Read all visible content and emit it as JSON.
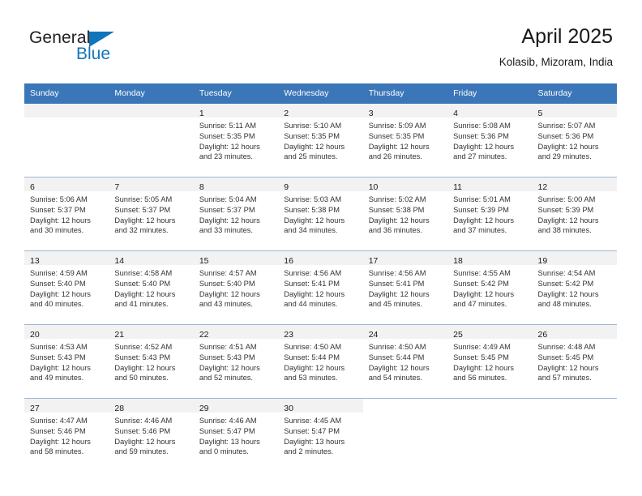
{
  "brand": {
    "name_top": "General",
    "name_bottom": "Blue",
    "triangle_color": "#1175bb",
    "text_color": "#231f20"
  },
  "header": {
    "title": "April 2025",
    "subtitle": "Kolasib, Mizoram, India"
  },
  "theme": {
    "header_bg": "#3a76b8",
    "header_text": "#ffffff",
    "daynum_band": "#f2f2f2",
    "grid_line": "#9db8d6",
    "cell_bg": "#ffffff"
  },
  "calendar": {
    "weekday_headers": [
      "Sunday",
      "Monday",
      "Tuesday",
      "Wednesday",
      "Thursday",
      "Friday",
      "Saturday"
    ],
    "weeks": [
      [
        {
          "day": "",
          "lines": []
        },
        {
          "day": "",
          "lines": []
        },
        {
          "day": "1",
          "lines": [
            "Sunrise: 5:11 AM",
            "Sunset: 5:35 PM",
            "Daylight: 12 hours",
            "and 23 minutes."
          ]
        },
        {
          "day": "2",
          "lines": [
            "Sunrise: 5:10 AM",
            "Sunset: 5:35 PM",
            "Daylight: 12 hours",
            "and 25 minutes."
          ]
        },
        {
          "day": "3",
          "lines": [
            "Sunrise: 5:09 AM",
            "Sunset: 5:35 PM",
            "Daylight: 12 hours",
            "and 26 minutes."
          ]
        },
        {
          "day": "4",
          "lines": [
            "Sunrise: 5:08 AM",
            "Sunset: 5:36 PM",
            "Daylight: 12 hours",
            "and 27 minutes."
          ]
        },
        {
          "day": "5",
          "lines": [
            "Sunrise: 5:07 AM",
            "Sunset: 5:36 PM",
            "Daylight: 12 hours",
            "and 29 minutes."
          ]
        }
      ],
      [
        {
          "day": "6",
          "lines": [
            "Sunrise: 5:06 AM",
            "Sunset: 5:37 PM",
            "Daylight: 12 hours",
            "and 30 minutes."
          ]
        },
        {
          "day": "7",
          "lines": [
            "Sunrise: 5:05 AM",
            "Sunset: 5:37 PM",
            "Daylight: 12 hours",
            "and 32 minutes."
          ]
        },
        {
          "day": "8",
          "lines": [
            "Sunrise: 5:04 AM",
            "Sunset: 5:37 PM",
            "Daylight: 12 hours",
            "and 33 minutes."
          ]
        },
        {
          "day": "9",
          "lines": [
            "Sunrise: 5:03 AM",
            "Sunset: 5:38 PM",
            "Daylight: 12 hours",
            "and 34 minutes."
          ]
        },
        {
          "day": "10",
          "lines": [
            "Sunrise: 5:02 AM",
            "Sunset: 5:38 PM",
            "Daylight: 12 hours",
            "and 36 minutes."
          ]
        },
        {
          "day": "11",
          "lines": [
            "Sunrise: 5:01 AM",
            "Sunset: 5:39 PM",
            "Daylight: 12 hours",
            "and 37 minutes."
          ]
        },
        {
          "day": "12",
          "lines": [
            "Sunrise: 5:00 AM",
            "Sunset: 5:39 PM",
            "Daylight: 12 hours",
            "and 38 minutes."
          ]
        }
      ],
      [
        {
          "day": "13",
          "lines": [
            "Sunrise: 4:59 AM",
            "Sunset: 5:40 PM",
            "Daylight: 12 hours",
            "and 40 minutes."
          ]
        },
        {
          "day": "14",
          "lines": [
            "Sunrise: 4:58 AM",
            "Sunset: 5:40 PM",
            "Daylight: 12 hours",
            "and 41 minutes."
          ]
        },
        {
          "day": "15",
          "lines": [
            "Sunrise: 4:57 AM",
            "Sunset: 5:40 PM",
            "Daylight: 12 hours",
            "and 43 minutes."
          ]
        },
        {
          "day": "16",
          "lines": [
            "Sunrise: 4:56 AM",
            "Sunset: 5:41 PM",
            "Daylight: 12 hours",
            "and 44 minutes."
          ]
        },
        {
          "day": "17",
          "lines": [
            "Sunrise: 4:56 AM",
            "Sunset: 5:41 PM",
            "Daylight: 12 hours",
            "and 45 minutes."
          ]
        },
        {
          "day": "18",
          "lines": [
            "Sunrise: 4:55 AM",
            "Sunset: 5:42 PM",
            "Daylight: 12 hours",
            "and 47 minutes."
          ]
        },
        {
          "day": "19",
          "lines": [
            "Sunrise: 4:54 AM",
            "Sunset: 5:42 PM",
            "Daylight: 12 hours",
            "and 48 minutes."
          ]
        }
      ],
      [
        {
          "day": "20",
          "lines": [
            "Sunrise: 4:53 AM",
            "Sunset: 5:43 PM",
            "Daylight: 12 hours",
            "and 49 minutes."
          ]
        },
        {
          "day": "21",
          "lines": [
            "Sunrise: 4:52 AM",
            "Sunset: 5:43 PM",
            "Daylight: 12 hours",
            "and 50 minutes."
          ]
        },
        {
          "day": "22",
          "lines": [
            "Sunrise: 4:51 AM",
            "Sunset: 5:43 PM",
            "Daylight: 12 hours",
            "and 52 minutes."
          ]
        },
        {
          "day": "23",
          "lines": [
            "Sunrise: 4:50 AM",
            "Sunset: 5:44 PM",
            "Daylight: 12 hours",
            "and 53 minutes."
          ]
        },
        {
          "day": "24",
          "lines": [
            "Sunrise: 4:50 AM",
            "Sunset: 5:44 PM",
            "Daylight: 12 hours",
            "and 54 minutes."
          ]
        },
        {
          "day": "25",
          "lines": [
            "Sunrise: 4:49 AM",
            "Sunset: 5:45 PM",
            "Daylight: 12 hours",
            "and 56 minutes."
          ]
        },
        {
          "day": "26",
          "lines": [
            "Sunrise: 4:48 AM",
            "Sunset: 5:45 PM",
            "Daylight: 12 hours",
            "and 57 minutes."
          ]
        }
      ],
      [
        {
          "day": "27",
          "lines": [
            "Sunrise: 4:47 AM",
            "Sunset: 5:46 PM",
            "Daylight: 12 hours",
            "and 58 minutes."
          ]
        },
        {
          "day": "28",
          "lines": [
            "Sunrise: 4:46 AM",
            "Sunset: 5:46 PM",
            "Daylight: 12 hours",
            "and 59 minutes."
          ]
        },
        {
          "day": "29",
          "lines": [
            "Sunrise: 4:46 AM",
            "Sunset: 5:47 PM",
            "Daylight: 13 hours",
            "and 0 minutes."
          ]
        },
        {
          "day": "30",
          "lines": [
            "Sunrise: 4:45 AM",
            "Sunset: 5:47 PM",
            "Daylight: 13 hours",
            "and 2 minutes."
          ]
        },
        {
          "day": "",
          "lines": []
        },
        {
          "day": "",
          "lines": []
        },
        {
          "day": "",
          "lines": []
        }
      ]
    ]
  }
}
